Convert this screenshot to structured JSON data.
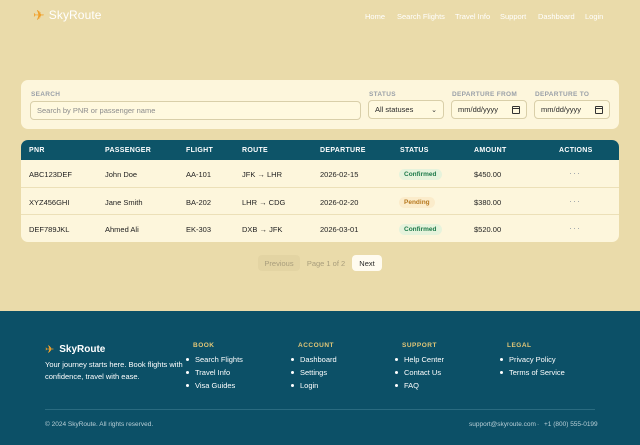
{
  "header": {
    "brand": "SkyRoute",
    "nav": [
      "Home",
      "Search Flights",
      "Travel Info",
      "Support",
      "Dashboard",
      "Login"
    ]
  },
  "filters": {
    "search_label": "SEARCH",
    "search_placeholder": "Search by PNR or passenger name",
    "status_label": "STATUS",
    "status_value": "All statuses",
    "from_label": "DEPARTURE FROM",
    "from_value": "mm/dd/yyyy",
    "to_label": "DEPARTURE TO",
    "to_value": "mm/dd/yyyy"
  },
  "table": {
    "columns": [
      "PNR",
      "PASSENGER",
      "FLIGHT",
      "ROUTE",
      "DEPARTURE",
      "STATUS",
      "AMOUNT",
      "ACTIONS"
    ],
    "rows": [
      {
        "pnr": "ABC123DEF",
        "passenger": "John Doe",
        "flight": "AA-101",
        "route": "JFK → LHR",
        "departure": "2026-02-15",
        "status": "Confirmed",
        "amount": "$450.00",
        "actions": "···"
      },
      {
        "pnr": "XYZ456GHI",
        "passenger": "Jane Smith",
        "flight": "BA-202",
        "route": "LHR → CDG",
        "departure": "2026-02-20",
        "status": "Pending",
        "amount": "$380.00",
        "actions": "···"
      },
      {
        "pnr": "DEF789JKL",
        "passenger": "Ahmed Ali",
        "flight": "EK-303",
        "route": "DXB → JFK",
        "departure": "2026-03-01",
        "status": "Confirmed",
        "amount": "$520.00",
        "actions": "···"
      }
    ]
  },
  "pagination": {
    "previous": "Previous",
    "info": "Page 1 of 2",
    "next": "Next"
  },
  "footer": {
    "brand": "SkyRoute",
    "tagline": "Your journey starts here. Book flights with confidence, travel with ease.",
    "columns": [
      {
        "title": "BOOK",
        "items": [
          "Search Flights",
          "Travel Info",
          "Visa Guides"
        ]
      },
      {
        "title": "ACCOUNT",
        "items": [
          "Dashboard",
          "Settings",
          "Login"
        ]
      },
      {
        "title": "SUPPORT",
        "items": [
          "Help Center",
          "Contact Us",
          "FAQ"
        ]
      },
      {
        "title": "LEGAL",
        "items": [
          "Privacy Policy",
          "Terms of Service"
        ]
      }
    ],
    "copyright": "© 2024 SkyRoute. All rights reserved.",
    "email": "support@skyroute.com",
    "separator": "·",
    "phone": "+1 (800) 555-0199"
  },
  "colors": {
    "accent": "#0d5468",
    "brand_icon": "#f0a02a",
    "background": "#eadbaa"
  },
  "icons": {
    "brand": "plane-icon",
    "calendar": "calendar-icon",
    "actions": "more-icon"
  }
}
